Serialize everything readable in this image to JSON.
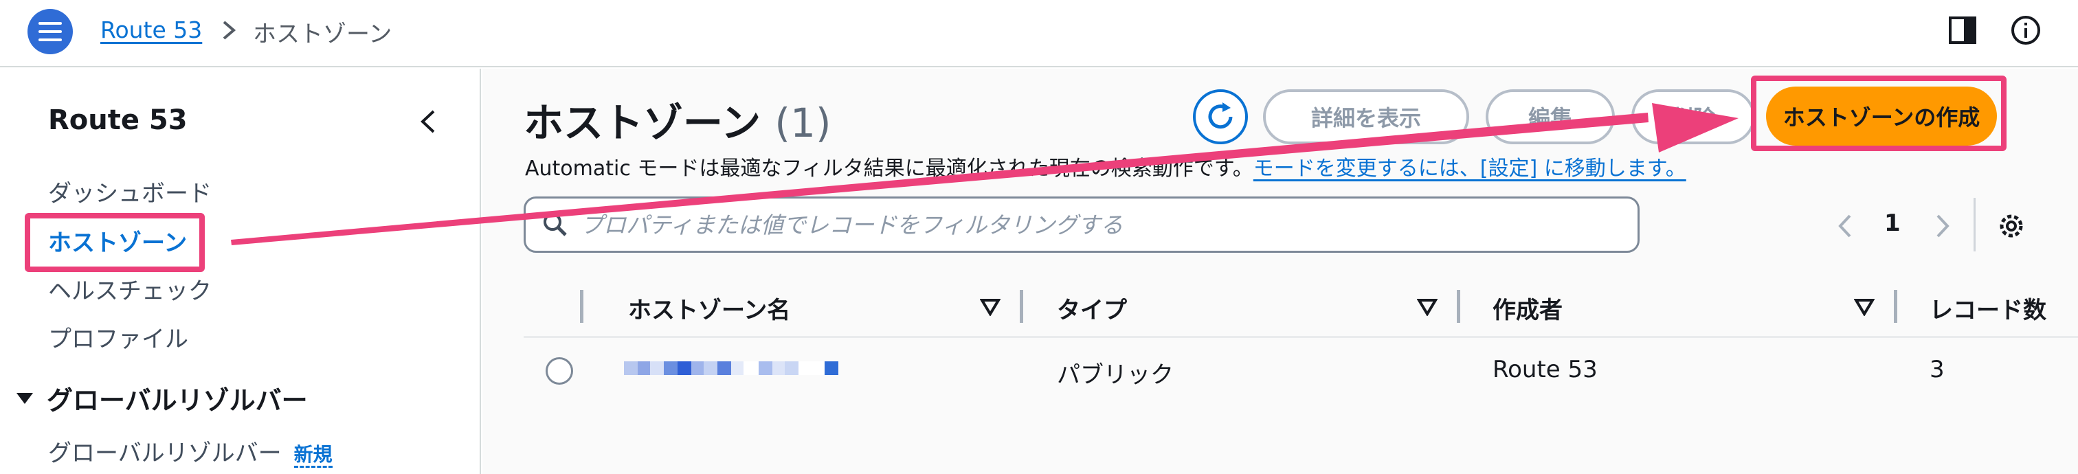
{
  "header": {
    "breadcrumb_root": "Route 53",
    "breadcrumb_current": "ホストゾーン"
  },
  "sidebar": {
    "title": "Route 53",
    "items": [
      {
        "label": "ダッシュボード"
      },
      {
        "label": "ホストゾーン"
      },
      {
        "label": "ヘルスチェック"
      },
      {
        "label": "プロファイル"
      }
    ],
    "section": {
      "label": "グローバルリゾルバー",
      "items": [
        {
          "label": "グローバルリゾルバー",
          "badge": "新規"
        }
      ]
    }
  },
  "main": {
    "title": "ホストゾーン",
    "count": "(1)",
    "buttons": {
      "details": "詳細を表示",
      "edit": "編集",
      "delete": "削除",
      "create": "ホストゾーンの作成"
    },
    "info_text": "Automatic モードは最適なフィルタ結果に最適化された現在の検索動作です。",
    "info_link": "モードを変更するには、[設定] に移動します。",
    "search_placeholder": "プロパティまたは値でレコードをフィルタリングする",
    "page_number": "1",
    "columns": [
      "ホストゾーン名",
      "タイプ",
      "作成者",
      "レコード数"
    ],
    "rows": [
      {
        "name": "",
        "type": "パブリック",
        "created_by": "Route 53",
        "record_count": "3"
      }
    ]
  },
  "colors": {
    "accent": "#0972d3",
    "primary_button": "#ff9900",
    "annotation": "#ec407a",
    "menu_button": "#2f6cd6"
  }
}
